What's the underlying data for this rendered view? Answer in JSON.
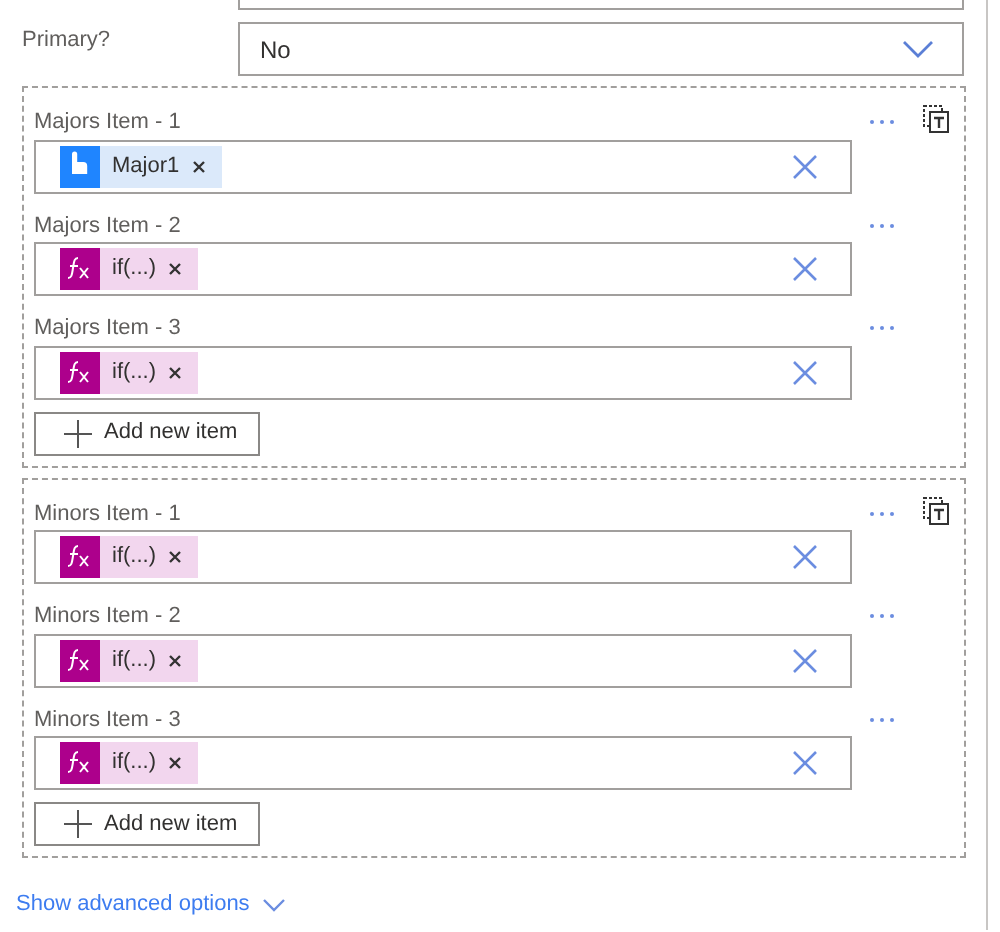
{
  "primary": {
    "label": "Primary?",
    "value": "No"
  },
  "groups": [
    {
      "items": [
        {
          "label": "Majors Item - 1",
          "token": {
            "kind": "dynamic",
            "text": "Major1"
          }
        },
        {
          "label": "Majors Item - 2",
          "token": {
            "kind": "expression",
            "text": "if(...)"
          }
        },
        {
          "label": "Majors Item - 3",
          "token": {
            "kind": "expression",
            "text": "if(...)"
          }
        }
      ],
      "add_button": "Add new item"
    },
    {
      "items": [
        {
          "label": "Minors Item - 1",
          "token": {
            "kind": "expression",
            "text": "if(...)"
          }
        },
        {
          "label": "Minors Item - 2",
          "token": {
            "kind": "expression",
            "text": "if(...)"
          }
        },
        {
          "label": "Minors Item - 3",
          "token": {
            "kind": "expression",
            "text": "if(...)"
          }
        }
      ],
      "add_button": "Add new item"
    }
  ],
  "advanced_link": "Show advanced options"
}
